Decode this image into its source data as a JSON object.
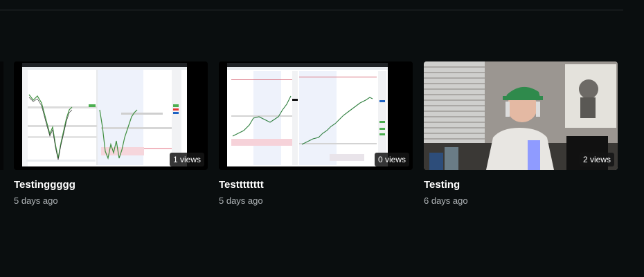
{
  "videos": [
    {
      "title": "Testinggggg",
      "age": "5 days ago",
      "views": "1 views",
      "thumb": "trading-chart-split-thumbnail"
    },
    {
      "title": "Testttttttt",
      "age": "5 days ago",
      "views": "0 views",
      "thumb": "trading-chart-uptrend-thumbnail"
    },
    {
      "title": "Testing",
      "age": "6 days ago",
      "views": "2 views",
      "thumb": "webcam-person-thumbnail"
    }
  ],
  "colors": {
    "background": "#0a0e0f",
    "meta_text": "#b0b5b8"
  }
}
